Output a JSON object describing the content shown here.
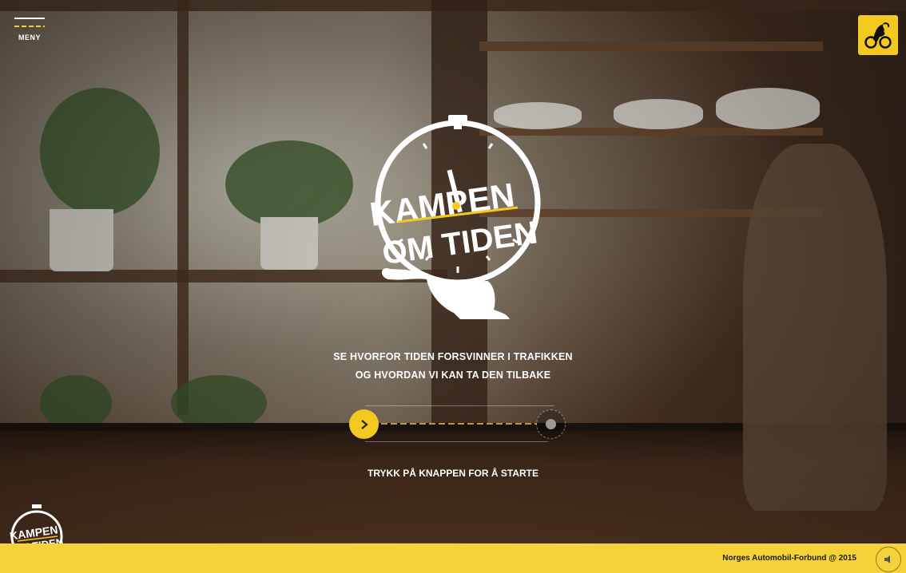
{
  "menu": {
    "label": "MENY",
    "icon": "menu-icon"
  },
  "badge": {
    "icon": "lion-wheel-icon",
    "color": "#f4c91f"
  },
  "logo": {
    "line1": "KAMPEN",
    "line2": "OM TIDEN"
  },
  "tagline": {
    "line1": "SE HVORFOR TIDEN FORSVINNER I TRAFIKKEN",
    "line2": "OG HVORDAN VI KAN TA DEN TILBAKE"
  },
  "slider": {
    "knob_icon": "chevron-right-icon",
    "target_icon": "dot-icon"
  },
  "instruction": "TRYKK PÅ KNAPPEN FOR Å STARTE",
  "footer": {
    "copyright": "Norges Automobil-Forbund @ 2015",
    "sound_icon": "speaker-icon",
    "logo_line1": "KAMPEN",
    "logo_line2": "OM TIDEN"
  },
  "colors": {
    "accent": "#f4c91f",
    "footer": "#f5d23a"
  }
}
